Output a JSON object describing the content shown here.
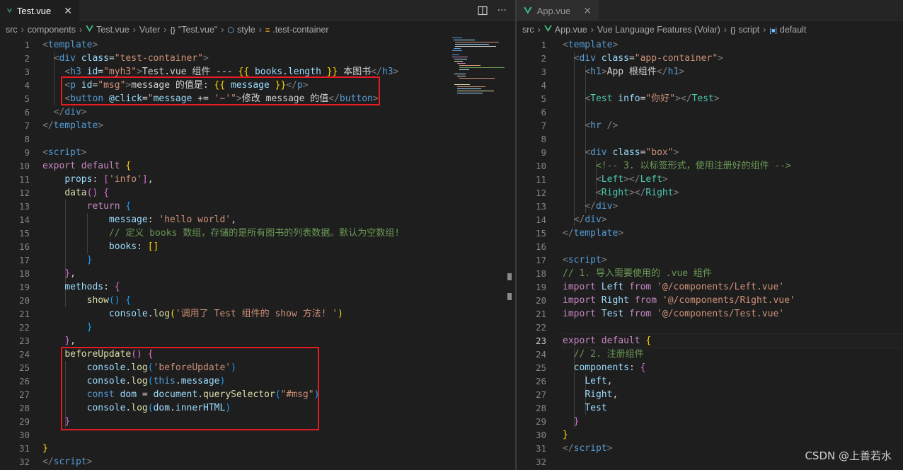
{
  "colors": {
    "background": "#1e1e1e",
    "tab_bar": "#252526",
    "tag": "#569cd6",
    "attr": "#9cdcfe",
    "string": "#ce9178",
    "keyword": "#c586c0",
    "function": "#dcdcaa",
    "comment": "#6a9955",
    "highlight_box": "#e51b23",
    "vue_logo": "#41b883"
  },
  "left": {
    "tab": {
      "label": "Test.vue",
      "icon": "vue-icon",
      "close": "✕"
    },
    "actions": {
      "split": "split-editor-icon",
      "more": "···"
    },
    "breadcrumbs": [
      {
        "label": "src"
      },
      {
        "label": "components"
      },
      {
        "label": "Test.vue",
        "icon": "vue-icon"
      },
      {
        "label": "Vuter"
      },
      {
        "label": "\"Test.vue\"",
        "icon": "braces-icon"
      },
      {
        "label": "style",
        "icon": "cube-icon"
      },
      {
        "label": ".test-container",
        "icon": "class-icon"
      }
    ],
    "current_line": 0,
    "lines": [
      [
        [
          "t-punct",
          "<"
        ],
        [
          "t-tag",
          "template"
        ],
        [
          "t-punct",
          ">"
        ]
      ],
      [
        [
          "t-text",
          "  "
        ],
        [
          "t-punct",
          "<"
        ],
        [
          "t-tag",
          "div"
        ],
        [
          "t-text",
          " "
        ],
        [
          "t-attr",
          "class"
        ],
        [
          "t-text",
          "="
        ],
        [
          "t-str",
          "\"test-container\""
        ],
        [
          "t-punct",
          ">"
        ]
      ],
      [
        [
          "t-text",
          "    "
        ],
        [
          "t-punct",
          "<"
        ],
        [
          "t-tag",
          "h3"
        ],
        [
          "t-text",
          " "
        ],
        [
          "t-attr",
          "id"
        ],
        [
          "t-text",
          "="
        ],
        [
          "t-str",
          "\"myh3\""
        ],
        [
          "t-punct",
          ">"
        ],
        [
          "t-text",
          "Test.vue 组件 --- "
        ],
        [
          "t-b1",
          "{{"
        ],
        [
          "t-text",
          " "
        ],
        [
          "t-var",
          "books"
        ],
        [
          "t-text",
          "."
        ],
        [
          "t-var",
          "length"
        ],
        [
          "t-text",
          " "
        ],
        [
          "t-b1",
          "}}"
        ],
        [
          "t-text",
          " 本图书"
        ],
        [
          "t-punct",
          "</"
        ],
        [
          "t-tag",
          "h3"
        ],
        [
          "t-punct",
          ">"
        ]
      ],
      [
        [
          "t-text",
          "    "
        ],
        [
          "t-punct",
          "<"
        ],
        [
          "t-tag",
          "p"
        ],
        [
          "t-text",
          " "
        ],
        [
          "t-attr",
          "id"
        ],
        [
          "t-text",
          "="
        ],
        [
          "t-str",
          "\"msg\""
        ],
        [
          "t-punct",
          ">"
        ],
        [
          "t-text",
          "message 的值是: "
        ],
        [
          "t-b1",
          "{{"
        ],
        [
          "t-text",
          " "
        ],
        [
          "t-var",
          "message"
        ],
        [
          "t-text",
          " "
        ],
        [
          "t-b1",
          "}}"
        ],
        [
          "t-punct",
          "</"
        ],
        [
          "t-tag",
          "p"
        ],
        [
          "t-punct",
          ">"
        ]
      ],
      [
        [
          "t-text",
          "    "
        ],
        [
          "t-punct",
          "<"
        ],
        [
          "t-tag",
          "button"
        ],
        [
          "t-text",
          " "
        ],
        [
          "t-attr",
          "@click"
        ],
        [
          "t-text",
          "="
        ],
        [
          "t-str",
          "\""
        ],
        [
          "t-var",
          "message"
        ],
        [
          "t-text",
          " += "
        ],
        [
          "t-str",
          "'~'"
        ],
        [
          "t-str",
          "\""
        ],
        [
          "t-punct",
          ">"
        ],
        [
          "t-text",
          "修改 message 的值"
        ],
        [
          "t-punct",
          "</"
        ],
        [
          "t-tag",
          "button"
        ],
        [
          "t-punct",
          ">"
        ]
      ],
      [
        [
          "t-text",
          "  "
        ],
        [
          "t-punct",
          "</"
        ],
        [
          "t-tag",
          "div"
        ],
        [
          "t-punct",
          ">"
        ]
      ],
      [
        [
          "t-punct",
          "</"
        ],
        [
          "t-tag",
          "template"
        ],
        [
          "t-punct",
          ">"
        ]
      ],
      [],
      [
        [
          "t-punct",
          "<"
        ],
        [
          "t-tag",
          "script"
        ],
        [
          "t-punct",
          ">"
        ]
      ],
      [
        [
          "t-kw",
          "export"
        ],
        [
          "t-text",
          " "
        ],
        [
          "t-kw",
          "default"
        ],
        [
          "t-text",
          " "
        ],
        [
          "t-b1",
          "{"
        ]
      ],
      [
        [
          "t-text",
          "    "
        ],
        [
          "t-var",
          "props"
        ],
        [
          "t-text",
          ": "
        ],
        [
          "t-b2",
          "["
        ],
        [
          "t-str",
          "'info'"
        ],
        [
          "t-b2",
          "]"
        ],
        [
          "t-text",
          ","
        ]
      ],
      [
        [
          "t-text",
          "    "
        ],
        [
          "t-fn",
          "data"
        ],
        [
          "t-b2",
          "()"
        ],
        [
          "t-text",
          " "
        ],
        [
          "t-b2",
          "{"
        ]
      ],
      [
        [
          "t-text",
          "        "
        ],
        [
          "t-kw",
          "return"
        ],
        [
          "t-text",
          " "
        ],
        [
          "t-b3",
          "{"
        ]
      ],
      [
        [
          "t-text",
          "            "
        ],
        [
          "t-var",
          "message"
        ],
        [
          "t-text",
          ": "
        ],
        [
          "t-str",
          "'hello world'"
        ],
        [
          "t-text",
          ","
        ]
      ],
      [
        [
          "t-text",
          "            "
        ],
        [
          "t-cmt",
          "// 定义 books 数组，存储的是所有图书的列表数据。默认为空数组!"
        ]
      ],
      [
        [
          "t-text",
          "            "
        ],
        [
          "t-var",
          "books"
        ],
        [
          "t-text",
          ": "
        ],
        [
          "t-b1",
          "[]"
        ]
      ],
      [
        [
          "t-text",
          "        "
        ],
        [
          "t-b3",
          "}"
        ]
      ],
      [
        [
          "t-text",
          "    "
        ],
        [
          "t-b2",
          "}"
        ],
        [
          "t-text",
          ","
        ]
      ],
      [
        [
          "t-text",
          "    "
        ],
        [
          "t-var",
          "methods"
        ],
        [
          "t-text",
          ": "
        ],
        [
          "t-b2",
          "{"
        ]
      ],
      [
        [
          "t-text",
          "        "
        ],
        [
          "t-fn",
          "show"
        ],
        [
          "t-b3",
          "()"
        ],
        [
          "t-text",
          " "
        ],
        [
          "t-b3",
          "{"
        ]
      ],
      [
        [
          "t-text",
          "            "
        ],
        [
          "t-var",
          "console"
        ],
        [
          "t-text",
          "."
        ],
        [
          "t-fn",
          "log"
        ],
        [
          "t-b1",
          "("
        ],
        [
          "t-str",
          "'调用了 Test 组件的 show 方法! '"
        ],
        [
          "t-b1",
          ")"
        ]
      ],
      [
        [
          "t-text",
          "        "
        ],
        [
          "t-b3",
          "}"
        ]
      ],
      [
        [
          "t-text",
          "    "
        ],
        [
          "t-b2",
          "}"
        ],
        [
          "t-text",
          ","
        ]
      ],
      [
        [
          "t-text",
          "    "
        ],
        [
          "t-fn",
          "beforeUpdate"
        ],
        [
          "t-b2",
          "()"
        ],
        [
          "t-text",
          " "
        ],
        [
          "t-b2",
          "{"
        ]
      ],
      [
        [
          "t-text",
          "        "
        ],
        [
          "t-var",
          "console"
        ],
        [
          "t-text",
          "."
        ],
        [
          "t-fn",
          "log"
        ],
        [
          "t-b3",
          "("
        ],
        [
          "t-str",
          "'beforeUpdate'"
        ],
        [
          "t-b3",
          ")"
        ]
      ],
      [
        [
          "t-text",
          "        "
        ],
        [
          "t-var",
          "console"
        ],
        [
          "t-text",
          "."
        ],
        [
          "t-fn",
          "log"
        ],
        [
          "t-b3",
          "("
        ],
        [
          "t-kw2",
          "this"
        ],
        [
          "t-text",
          "."
        ],
        [
          "t-var",
          "message"
        ],
        [
          "t-b3",
          ")"
        ]
      ],
      [
        [
          "t-text",
          "        "
        ],
        [
          "t-kw2",
          "const"
        ],
        [
          "t-text",
          " "
        ],
        [
          "t-var",
          "dom"
        ],
        [
          "t-text",
          " = "
        ],
        [
          "t-var",
          "document"
        ],
        [
          "t-text",
          "."
        ],
        [
          "t-fn",
          "querySelector"
        ],
        [
          "t-b3",
          "("
        ],
        [
          "t-str",
          "\"#msg\""
        ],
        [
          "t-b3",
          ")"
        ]
      ],
      [
        [
          "t-text",
          "        "
        ],
        [
          "t-var",
          "console"
        ],
        [
          "t-text",
          "."
        ],
        [
          "t-fn",
          "log"
        ],
        [
          "t-b3",
          "("
        ],
        [
          "t-var",
          "dom"
        ],
        [
          "t-text",
          "."
        ],
        [
          "t-var",
          "innerHTML"
        ],
        [
          "t-b3",
          ")"
        ]
      ],
      [
        [
          "t-text",
          "    "
        ],
        [
          "t-b2",
          "}"
        ]
      ],
      [],
      [
        [
          "t-b1",
          "}"
        ]
      ],
      [
        [
          "t-punct",
          "</"
        ],
        [
          "t-tag",
          "script"
        ],
        [
          "t-punct",
          ">"
        ]
      ]
    ]
  },
  "right": {
    "tab": {
      "label": "App.vue",
      "icon": "vue-icon",
      "close": "✕"
    },
    "breadcrumbs": [
      {
        "label": "src"
      },
      {
        "label": "App.vue",
        "icon": "vue-icon"
      },
      {
        "label": "Vue Language Features (Volar)"
      },
      {
        "label": "script",
        "icon": "braces-icon"
      },
      {
        "label": "default",
        "icon": "variable-icon"
      }
    ],
    "current_line": 23,
    "lines": [
      [
        [
          "t-punct",
          "<"
        ],
        [
          "t-tag",
          "template"
        ],
        [
          "t-punct",
          ">"
        ]
      ],
      [
        [
          "t-text",
          "  "
        ],
        [
          "t-punct",
          "<"
        ],
        [
          "t-tag",
          "div"
        ],
        [
          "t-text",
          " "
        ],
        [
          "t-attr",
          "class"
        ],
        [
          "t-text",
          "="
        ],
        [
          "t-str",
          "\"app-container\""
        ],
        [
          "t-punct",
          ">"
        ]
      ],
      [
        [
          "t-text",
          "    "
        ],
        [
          "t-punct",
          "<"
        ],
        [
          "t-tag",
          "h1"
        ],
        [
          "t-punct",
          ">"
        ],
        [
          "t-text",
          "App 根组件"
        ],
        [
          "t-punct",
          "</"
        ],
        [
          "t-tag",
          "h1"
        ],
        [
          "t-punct",
          ">"
        ]
      ],
      [],
      [
        [
          "t-text",
          "    "
        ],
        [
          "t-punct",
          "<"
        ],
        [
          "t-comp",
          "Test"
        ],
        [
          "t-text",
          " "
        ],
        [
          "t-attr",
          "info"
        ],
        [
          "t-text",
          "="
        ],
        [
          "t-str",
          "\"你好\""
        ],
        [
          "t-punct",
          "></"
        ],
        [
          "t-comp",
          "Test"
        ],
        [
          "t-punct",
          ">"
        ]
      ],
      [],
      [
        [
          "t-text",
          "    "
        ],
        [
          "t-punct",
          "<"
        ],
        [
          "t-tag",
          "hr"
        ],
        [
          "t-text",
          " "
        ],
        [
          "t-punct",
          "/>"
        ]
      ],
      [],
      [
        [
          "t-text",
          "    "
        ],
        [
          "t-punct",
          "<"
        ],
        [
          "t-tag",
          "div"
        ],
        [
          "t-text",
          " "
        ],
        [
          "t-attr",
          "class"
        ],
        [
          "t-text",
          "="
        ],
        [
          "t-str",
          "\"box\""
        ],
        [
          "t-punct",
          ">"
        ]
      ],
      [
        [
          "t-text",
          "      "
        ],
        [
          "t-cmt",
          "<!-- 3. 以标签形式，使用注册好的组件 -->"
        ]
      ],
      [
        [
          "t-text",
          "      "
        ],
        [
          "t-punct",
          "<"
        ],
        [
          "t-comp",
          "Left"
        ],
        [
          "t-punct",
          "></"
        ],
        [
          "t-comp",
          "Left"
        ],
        [
          "t-punct",
          ">"
        ]
      ],
      [
        [
          "t-text",
          "      "
        ],
        [
          "t-punct",
          "<"
        ],
        [
          "t-comp",
          "Right"
        ],
        [
          "t-punct",
          "></"
        ],
        [
          "t-comp",
          "Right"
        ],
        [
          "t-punct",
          ">"
        ]
      ],
      [
        [
          "t-text",
          "    "
        ],
        [
          "t-punct",
          "</"
        ],
        [
          "t-tag",
          "div"
        ],
        [
          "t-punct",
          ">"
        ]
      ],
      [
        [
          "t-text",
          "  "
        ],
        [
          "t-punct",
          "</"
        ],
        [
          "t-tag",
          "div"
        ],
        [
          "t-punct",
          ">"
        ]
      ],
      [
        [
          "t-punct",
          "</"
        ],
        [
          "t-tag",
          "template"
        ],
        [
          "t-punct",
          ">"
        ]
      ],
      [],
      [
        [
          "t-punct",
          "<"
        ],
        [
          "t-tag",
          "script"
        ],
        [
          "t-punct",
          ">"
        ]
      ],
      [
        [
          "t-cmt",
          "// 1. 导入需要使用的 .vue 组件"
        ]
      ],
      [
        [
          "t-kw",
          "import"
        ],
        [
          "t-text",
          " "
        ],
        [
          "t-var",
          "Left"
        ],
        [
          "t-text",
          " "
        ],
        [
          "t-kw",
          "from"
        ],
        [
          "t-text",
          " "
        ],
        [
          "t-str",
          "'@/components/Left.vue'"
        ]
      ],
      [
        [
          "t-kw",
          "import"
        ],
        [
          "t-text",
          " "
        ],
        [
          "t-var",
          "Right"
        ],
        [
          "t-text",
          " "
        ],
        [
          "t-kw",
          "from"
        ],
        [
          "t-text",
          " "
        ],
        [
          "t-str",
          "'@/components/Right.vue'"
        ]
      ],
      [
        [
          "t-kw",
          "import"
        ],
        [
          "t-text",
          " "
        ],
        [
          "t-var",
          "Test"
        ],
        [
          "t-text",
          " "
        ],
        [
          "t-kw",
          "from"
        ],
        [
          "t-text",
          " "
        ],
        [
          "t-str",
          "'@/components/Test.vue'"
        ]
      ],
      [],
      [
        [
          "t-kw",
          "export"
        ],
        [
          "t-text",
          " "
        ],
        [
          "t-kw",
          "default"
        ],
        [
          "t-text",
          " "
        ],
        [
          "t-b1",
          "{"
        ]
      ],
      [
        [
          "t-text",
          "  "
        ],
        [
          "t-cmt",
          "// 2. 注册组件"
        ]
      ],
      [
        [
          "t-text",
          "  "
        ],
        [
          "t-var",
          "components"
        ],
        [
          "t-text",
          ": "
        ],
        [
          "t-b2",
          "{"
        ]
      ],
      [
        [
          "t-text",
          "    "
        ],
        [
          "t-var",
          "Left"
        ],
        [
          "t-text",
          ","
        ]
      ],
      [
        [
          "t-text",
          "    "
        ],
        [
          "t-var",
          "Right"
        ],
        [
          "t-text",
          ","
        ]
      ],
      [
        [
          "t-text",
          "    "
        ],
        [
          "t-var",
          "Test"
        ]
      ],
      [
        [
          "t-text",
          "  "
        ],
        [
          "t-b2",
          "}"
        ]
      ],
      [
        [
          "t-b1",
          "}"
        ]
      ],
      [
        [
          "t-punct",
          "</"
        ],
        [
          "t-tag",
          "script"
        ],
        [
          "t-punct",
          ">"
        ]
      ],
      []
    ]
  },
  "watermark": "CSDN @上善若水"
}
